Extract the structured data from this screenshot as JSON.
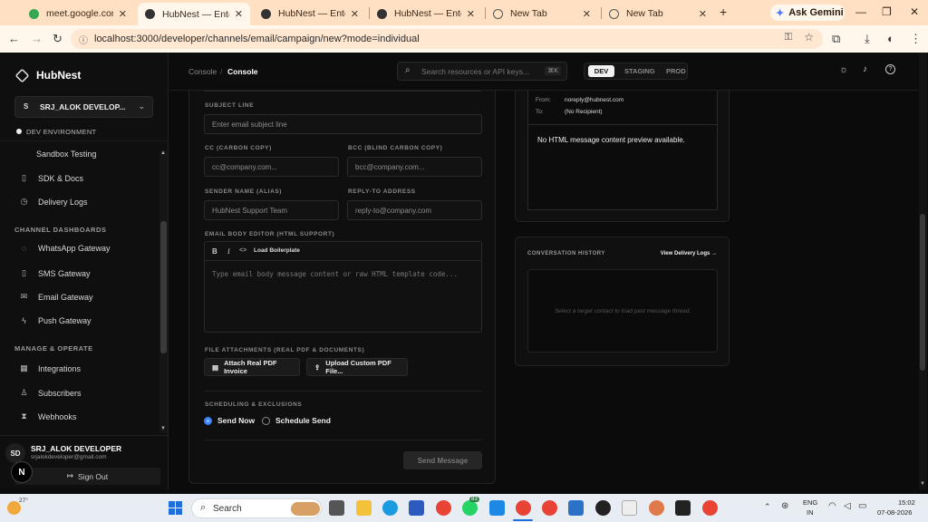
{
  "browser": {
    "tabs": [
      {
        "title": "meet.google.com"
      },
      {
        "title": "HubNest — Enterprise"
      },
      {
        "title": "HubNest — Enterprise"
      },
      {
        "title": "HubNest — Enterprise"
      },
      {
        "title": "New Tab"
      },
      {
        "title": "New Tab"
      }
    ],
    "new_tab": "+",
    "gemini": "Ask Gemini",
    "url": "localhost:3000/developer/channels/email/campaign/new?mode=individual"
  },
  "sidebar": {
    "brand": "HubNest",
    "account": "SRJ_ALOK DEVELOP...",
    "account_initial": "S",
    "env": "DEV ENVIRONMENT",
    "items_top": [
      "Sandbox Testing",
      "SDK & Docs",
      "Delivery Logs"
    ],
    "section_channels": "CHANNEL DASHBOARDS",
    "channels": [
      "WhatsApp Gateway",
      "SMS Gateway",
      "Email Gateway",
      "Push Gateway"
    ],
    "section_manage": "MANAGE & OPERATE",
    "manage": [
      "Integrations",
      "Subscribers",
      "Webhooks"
    ],
    "user": {
      "initials": "SD",
      "name": "SRJ_ALOK DEVELOPER",
      "email": "srjalokdeveloper@gmail.com",
      "signout": "Sign Out",
      "badge": "N"
    }
  },
  "topnav": {
    "crumb_root": "Console",
    "crumb_sep": "/",
    "crumb_current": "Console",
    "search_placeholder": "Search resources or API keys...",
    "search_kbd": "⌘K",
    "env_tabs": [
      "DEV",
      "STAGING",
      "PROD"
    ]
  },
  "form": {
    "subject_label": "SUBJECT LINE",
    "subject_placeholder": "Enter email subject line",
    "cc_label": "CC (CARBON COPY)",
    "cc_placeholder": "cc@company.com...",
    "bcc_label": "BCC (BLIND CARBON COPY)",
    "bcc_placeholder": "bcc@company.com...",
    "sender_label": "SENDER NAME (ALIAS)",
    "sender_placeholder": "HubNest Support Team",
    "reply_label": "REPLY-TO ADDRESS",
    "reply_placeholder": "reply-to@company.com",
    "body_label": "EMAIL BODY EDITOR (HTML SUPPORT)",
    "toolbar": {
      "bold": "B",
      "italic": "I",
      "code": "<>",
      "load": "Load Boilerplate"
    },
    "body_placeholder": "Type email body message content or raw HTML template code...",
    "attach_label": "FILE ATTACHMENTS (REAL PDF & DOCUMENTS)",
    "attach_invoice": "Attach Real PDF Invoice",
    "upload_pdf": "Upload Custom PDF File...",
    "sched_label": "SCHEDULING & EXCLUSIONS",
    "send_now": "Send Now",
    "schedule_send": "Schedule Send",
    "submit": "Send Message"
  },
  "preview": {
    "from_label": "From:",
    "from_value": "noreply@hubnest.com",
    "to_label": "To:",
    "to_value": "(No Recipient)",
    "empty": "No HTML message content preview available."
  },
  "history": {
    "title": "CONVERSATION HISTORY",
    "link": "View Delivery Logs →",
    "empty": "Select a target contact to load past message thread."
  },
  "taskbar": {
    "weather": "27°",
    "search": "Search",
    "lang": "ENG",
    "region": "IN",
    "time": "15:02",
    "date": "07-08-2026",
    "badge": "83"
  },
  "colors": {
    "accent": "#3b82f6",
    "bg": "#0b0b0b",
    "panel": "#111111",
    "border": "#2a2a2a",
    "browser": "#ffe0c2"
  }
}
